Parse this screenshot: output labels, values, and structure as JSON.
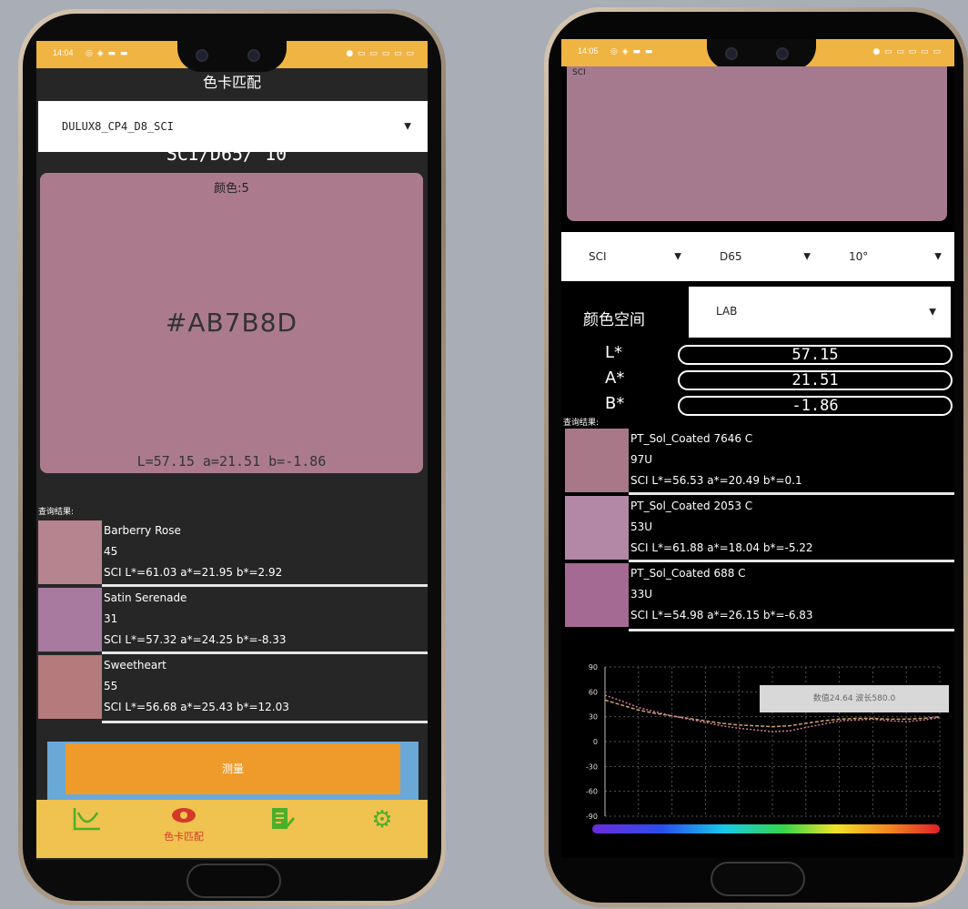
{
  "left_phone": {
    "status": {
      "time": "14:04",
      "icons_left": "◎ ◈ ▬ ▬",
      "icons_right": "● ▭ ▭ ▭ ▭ ▭"
    },
    "app_title": "色卡匹配",
    "library_dropdown": "DULUX8_CP4_D8_SCI",
    "conditions": "SCI/D65/ 10°",
    "color_index": "颜色:5",
    "hex": "#AB7B8D",
    "lab_readout": "L=57.15  a=21.51  b=-1.86",
    "swatch_color": "#ab7b8d",
    "query_label": "查询结果:",
    "results": [
      {
        "name": "Barberry Rose",
        "code": "45",
        "lab": "SCI L*=61.03  a*=21.95  b*=2.92",
        "color": "#b6848f"
      },
      {
        "name": "Satin Serenade",
        "code": "31",
        "lab": "SCI L*=57.32  a*=24.25  b*=-8.33",
        "color": "#a87a9f"
      },
      {
        "name": "Sweetheart",
        "code": "55",
        "lab": "SCI L*=56.68  a*=25.43  b*=12.03",
        "color": "#b47a7c"
      }
    ],
    "measure_button": "测量",
    "nav": {
      "match_label": "色卡匹配"
    }
  },
  "right_phone": {
    "status": {
      "time": "14:05",
      "icons_left": "◎ ◈ ▬ ▬",
      "icons_right": "● ▭ ▭ ▭ ▭ ▭"
    },
    "sample_label": "SCI",
    "swatch_color": "#a67a8e",
    "mode_select": "SCI",
    "illuminant_select": "D65",
    "observer_select": "10°",
    "color_space_label": "颜色空间",
    "color_space_select": "LAB",
    "lab_values": [
      {
        "name": "L*",
        "value": "57.15"
      },
      {
        "name": "A*",
        "value": "21.51"
      },
      {
        "name": "B*",
        "value": "-1.86"
      }
    ],
    "query_label": "查询结果:",
    "results": [
      {
        "name": "PT_Sol_Coated 7646 C",
        "code": "97U",
        "lab": "SCI L*=56.53  a*=20.49  b*=0.1",
        "color": "#a87888"
      },
      {
        "name": "PT_Sol_Coated 2053 C",
        "code": "53U",
        "lab": "SCI L*=61.88  a*=18.04  b*=-5.22",
        "color": "#b288a6"
      },
      {
        "name": "PT_Sol_Coated 688 C",
        "code": "33U",
        "lab": "SCI L*=54.98  a*=26.15  b*=-6.83",
        "color": "#a56a94"
      }
    ],
    "tooltip": "数值24.64  波长580.0",
    "chart_data": {
      "type": "line",
      "title": "",
      "xlabel": "",
      "ylabel": "",
      "y_ticks": [
        "90",
        "60",
        "30",
        "0",
        "-30",
        "-60",
        "-90"
      ],
      "ylim": [
        -90,
        90
      ],
      "grid": true,
      "series": [
        {
          "values": [
            50,
            44,
            38,
            34,
            31,
            28,
            25,
            22,
            20,
            19,
            18,
            19,
            22,
            25,
            27,
            28,
            28,
            27,
            27,
            28,
            30
          ]
        },
        {
          "values": [
            56,
            49,
            41,
            36,
            31,
            27,
            23,
            19,
            16,
            14,
            12,
            13,
            17,
            21,
            25,
            26,
            27,
            25,
            24,
            26,
            29
          ]
        }
      ]
    }
  }
}
